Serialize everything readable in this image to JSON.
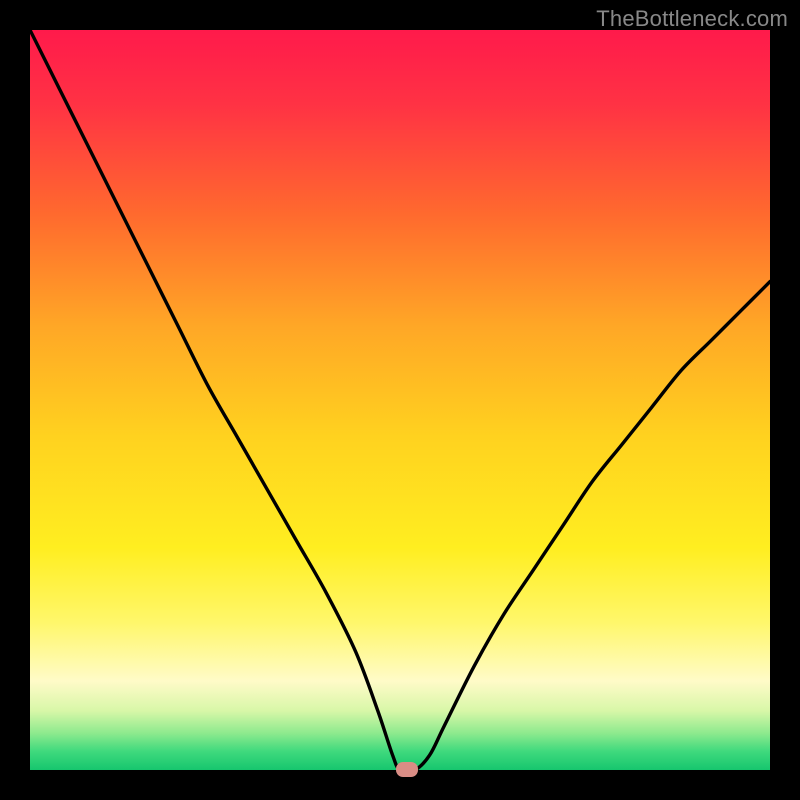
{
  "watermark": "TheBottleneck.com",
  "chart_data": {
    "type": "line",
    "title": "",
    "xlabel": "",
    "ylabel": "",
    "xlim": [
      0,
      100
    ],
    "ylim": [
      0,
      100
    ],
    "background_gradient": {
      "stops": [
        {
          "offset": 0.0,
          "color": "#ff1a4b"
        },
        {
          "offset": 0.1,
          "color": "#ff3244"
        },
        {
          "offset": 0.25,
          "color": "#ff6a2e"
        },
        {
          "offset": 0.4,
          "color": "#ffa726"
        },
        {
          "offset": 0.55,
          "color": "#ffd21f"
        },
        {
          "offset": 0.7,
          "color": "#ffee20"
        },
        {
          "offset": 0.8,
          "color": "#fff76a"
        },
        {
          "offset": 0.88,
          "color": "#fffbc8"
        },
        {
          "offset": 0.92,
          "color": "#d8f7a8"
        },
        {
          "offset": 0.95,
          "color": "#8eea8e"
        },
        {
          "offset": 0.975,
          "color": "#3fd97d"
        },
        {
          "offset": 1.0,
          "color": "#16c66e"
        }
      ]
    },
    "curve": {
      "x": [
        0,
        4,
        8,
        12,
        16,
        20,
        24,
        28,
        32,
        36,
        40,
        44,
        47,
        49,
        50,
        52,
        54,
        56,
        60,
        64,
        68,
        72,
        76,
        80,
        84,
        88,
        92,
        96,
        100
      ],
      "y": [
        100,
        92,
        84,
        76,
        68,
        60,
        52,
        45,
        38,
        31,
        24,
        16,
        8,
        2,
        0,
        0,
        2,
        6,
        14,
        21,
        27,
        33,
        39,
        44,
        49,
        54,
        58,
        62,
        66
      ]
    },
    "marker": {
      "x": 51,
      "y": 0,
      "color": "#d98d85"
    }
  }
}
